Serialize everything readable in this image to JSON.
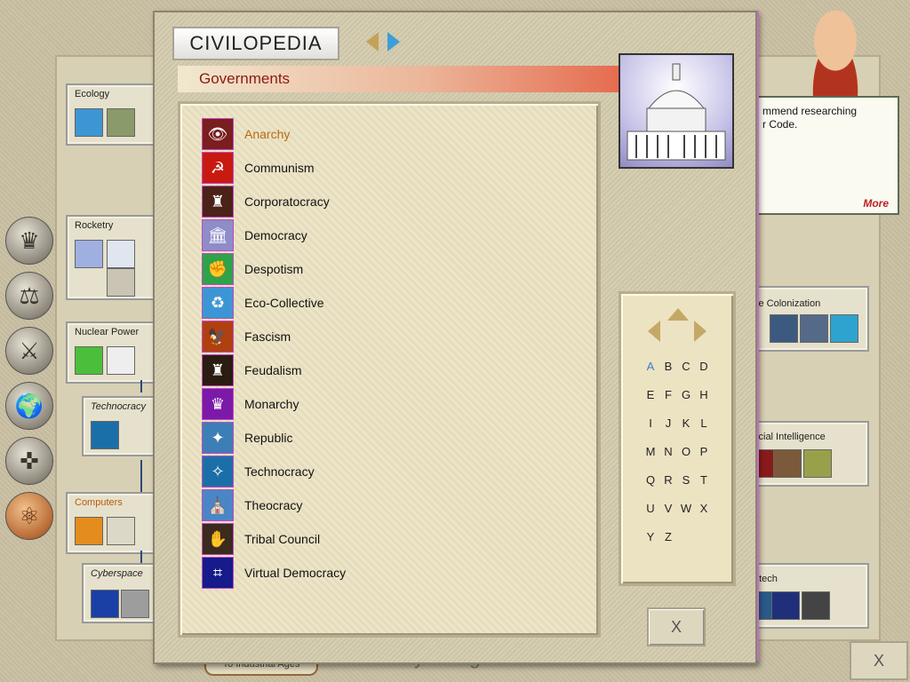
{
  "window": {
    "title": "CIVILOPEDIA",
    "section": "Governments"
  },
  "governments": [
    {
      "label": "Anarchy",
      "icon": "anarchy-icon",
      "color": "#7a1e1e",
      "glyph": "👁",
      "selected": true
    },
    {
      "label": "Communism",
      "icon": "hammer-sickle-icon",
      "color": "#c81a10",
      "glyph": "☭",
      "selected": false
    },
    {
      "label": "Corporatocracy",
      "icon": "corporate-icon",
      "color": "#4a2218",
      "glyph": "♜",
      "selected": false
    },
    {
      "label": "Democracy",
      "icon": "capitol-icon",
      "color": "#8e8cc9",
      "glyph": "🏛",
      "selected": false
    },
    {
      "label": "Despotism",
      "icon": "fist-icon",
      "color": "#2ea34a",
      "glyph": "✊",
      "selected": false
    },
    {
      "label": "Eco-Collective",
      "icon": "eco-icon",
      "color": "#3d96d4",
      "glyph": "♻",
      "selected": false
    },
    {
      "label": "Fascism",
      "icon": "eagle-icon",
      "color": "#b0400f",
      "glyph": "🦅",
      "selected": false
    },
    {
      "label": "Feudalism",
      "icon": "castle-icon",
      "color": "#2a1c10",
      "glyph": "♜",
      "selected": false
    },
    {
      "label": "Monarchy",
      "icon": "crown-icon",
      "color": "#7b1aa8",
      "glyph": "♛",
      "selected": false
    },
    {
      "label": "Republic",
      "icon": "republic-icon",
      "color": "#3c7fb6",
      "glyph": "✦",
      "selected": false
    },
    {
      "label": "Technocracy",
      "icon": "technocracy-icon",
      "color": "#1b6fa8",
      "glyph": "✧",
      "selected": false
    },
    {
      "label": "Theocracy",
      "icon": "theocracy-icon",
      "color": "#4a86c6",
      "glyph": "⛪",
      "selected": false
    },
    {
      "label": "Tribal Council",
      "icon": "tribal-icon",
      "color": "#3b2a1e",
      "glyph": "✋",
      "selected": false
    },
    {
      "label": "Virtual Democracy",
      "icon": "virtual-icon",
      "color": "#161a8a",
      "glyph": "⌗",
      "selected": false
    }
  ],
  "index": {
    "letters": [
      "A",
      "B",
      "C",
      "D",
      "E",
      "F",
      "G",
      "H",
      "I",
      "J",
      "K",
      "L",
      "M",
      "N",
      "O",
      "P",
      "Q",
      "R",
      "S",
      "T",
      "U",
      "V",
      "W",
      "X",
      "Y",
      "Z"
    ],
    "active": "A"
  },
  "close_label": "X",
  "advisor": {
    "message": "mmend researching\nr Code.",
    "more": "More"
  },
  "background": {
    "techs": [
      "Ecology",
      "Rocketry",
      "Nuclear Power",
      "Technocracy",
      "Computers",
      "Cyberspace",
      "ce Colonization",
      "ficial Intelligence",
      "otech"
    ],
    "age_button": "To Industrial Ages",
    "age_label": "Cyber Age",
    "close_label": "X"
  }
}
